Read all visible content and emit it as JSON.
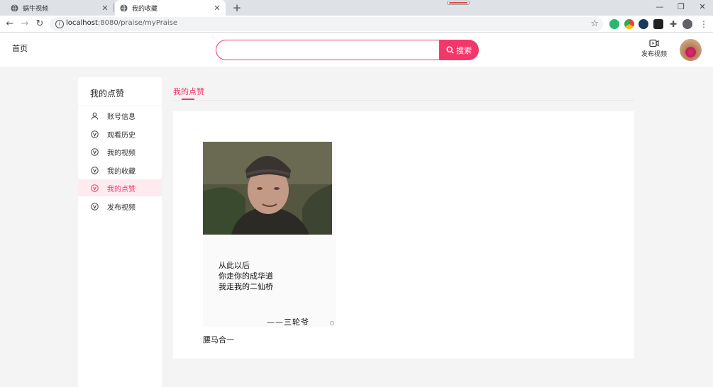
{
  "browser": {
    "tabs": [
      {
        "title": "蜗牛视频",
        "active": false
      },
      {
        "title": "我的收藏",
        "active": true
      }
    ],
    "tab_close_glyph": "✕",
    "new_tab_glyph": "+",
    "url_host": "localhost",
    "url_rest": ":8080/praise/myPraise",
    "window_controls": {
      "minimize": "—",
      "restore": "❐",
      "close": "✕"
    }
  },
  "header": {
    "home_label": "首页",
    "search": {
      "placeholder": "",
      "value": "",
      "button_label": "搜索"
    },
    "publish_label": "发布视频",
    "accent_color": "#f2386b"
  },
  "sidebar": {
    "title": "我的点赞",
    "items": [
      {
        "label": "账号信息",
        "icon": "user-icon",
        "active": false
      },
      {
        "label": "观看历史",
        "icon": "v-circle-icon",
        "active": false
      },
      {
        "label": "我的视频",
        "icon": "v-circle-icon",
        "active": false
      },
      {
        "label": "我的收藏",
        "icon": "v-circle-icon",
        "active": false
      },
      {
        "label": "我的点赞",
        "icon": "v-circle-icon",
        "active": true
      },
      {
        "label": "发布视频",
        "icon": "v-circle-icon",
        "active": false
      }
    ]
  },
  "main": {
    "tab_label": "我的点赞",
    "videos": [
      {
        "quote_lines": [
          "从此以后",
          "你走你的成华道",
          "我走我的二仙桥"
        ],
        "signature": "——三轮爷",
        "title": "腰马合一"
      }
    ]
  }
}
